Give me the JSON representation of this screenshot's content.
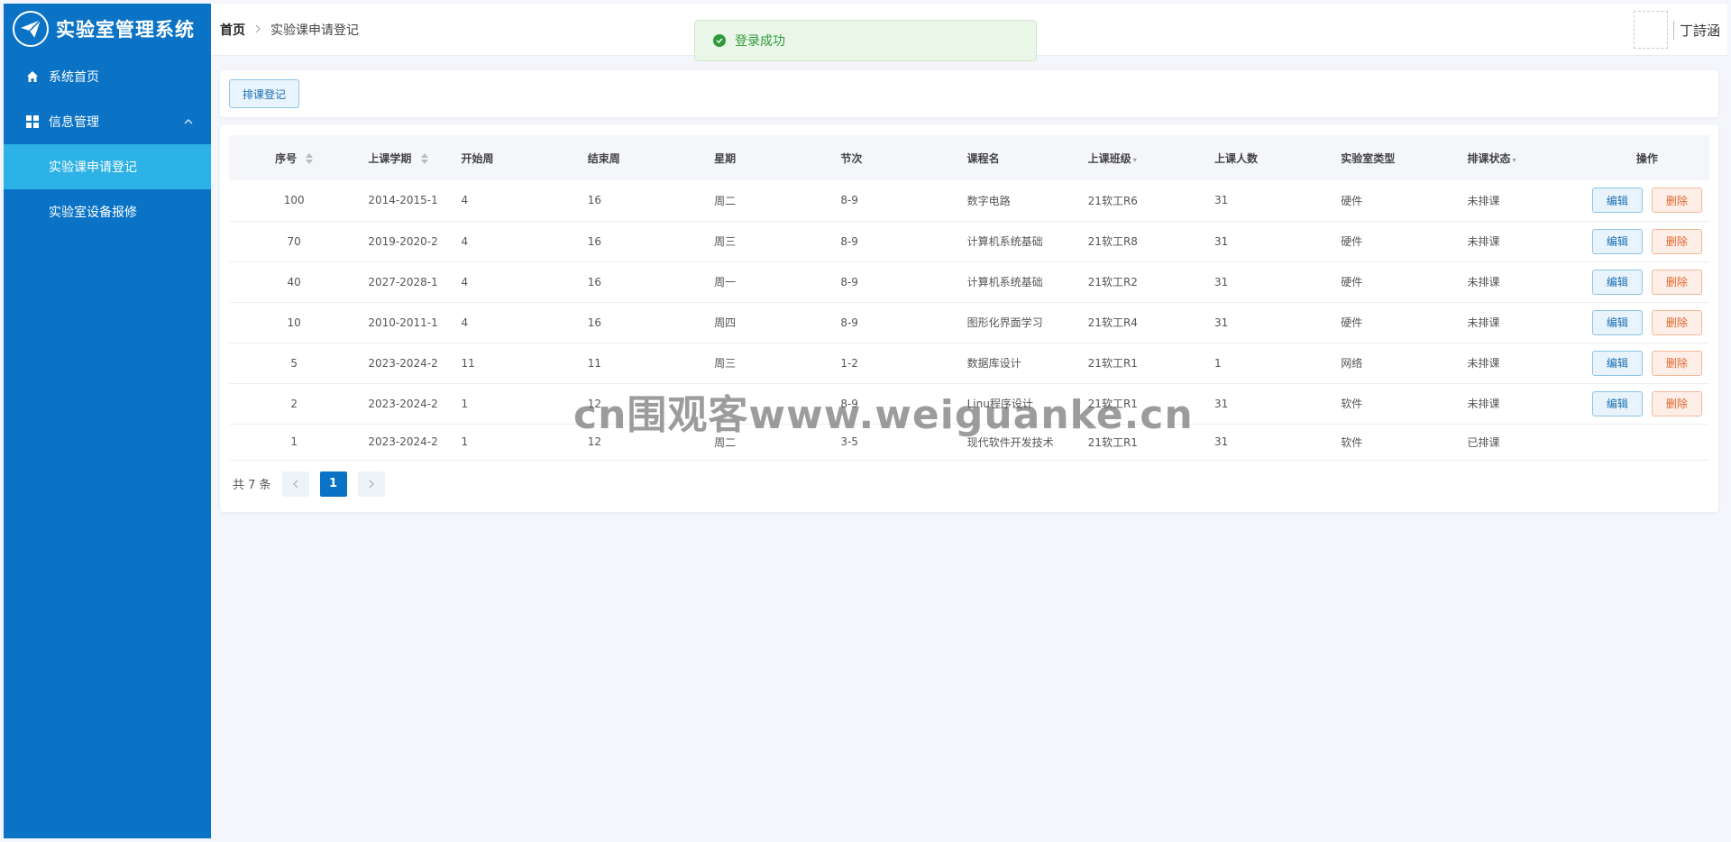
{
  "app": {
    "title": "实验室管理系统"
  },
  "sidebar": {
    "items": [
      {
        "label": "系统首页",
        "icon": "home-icon"
      },
      {
        "label": "信息管理",
        "icon": "grid-icon",
        "expanded": true
      }
    ],
    "submenu": [
      {
        "label": "实验课申请登记",
        "active": true
      },
      {
        "label": "实验室设备报修",
        "active": false
      }
    ]
  },
  "header": {
    "breadcrumb_home": "首页",
    "breadcrumb_current": "实验课申请登记",
    "user_name": "丁詩涵"
  },
  "toast": {
    "message": "登录成功"
  },
  "toolbar": {
    "schedule_label": "排课登记"
  },
  "table": {
    "columns": [
      "序号",
      "上课学期",
      "开始周",
      "结束周",
      "星期",
      "节次",
      "课程名",
      "上课班级",
      "上课人数",
      "实验室类型",
      "排课状态",
      "操作"
    ],
    "rows": [
      [
        "100",
        "2014-2015-1",
        "4",
        "16",
        "周二",
        "8-9",
        "数字电路",
        "21软工R6",
        "31",
        "硬件",
        "未排课"
      ],
      [
        "70",
        "2019-2020-2",
        "4",
        "16",
        "周三",
        "8-9",
        "计算机系统基础",
        "21软工R8",
        "31",
        "硬件",
        "未排课"
      ],
      [
        "40",
        "2027-2028-1",
        "4",
        "16",
        "周一",
        "8-9",
        "计算机系统基础",
        "21软工R2",
        "31",
        "硬件",
        "未排课"
      ],
      [
        "10",
        "2010-2011-1",
        "4",
        "16",
        "周四",
        "8-9",
        "图形化界面学习",
        "21软工R4",
        "31",
        "硬件",
        "未排课"
      ],
      [
        "5",
        "2023-2024-2",
        "11",
        "11",
        "周三",
        "1-2",
        "数据库设计",
        "21软工R1",
        "1",
        "网络",
        "未排课"
      ],
      [
        "2",
        "2023-2024-2",
        "1",
        "12",
        "",
        "8-9",
        "Linu程序设计",
        "21软工R1",
        "31",
        "软件",
        "未排课"
      ],
      [
        "1",
        "2023-2024-2",
        "1",
        "12",
        "周二",
        "3-5",
        "现代软件开发技术",
        "21软工R1",
        "31",
        "软件",
        "已排课"
      ]
    ],
    "edit_label": "编辑",
    "delete_label": "删除"
  },
  "pagination": {
    "total_text": "共 7 条",
    "current_page": "1"
  },
  "watermark": "cn围观客www.weiguanke.cn",
  "colors": {
    "sidebar": "#0a73c6",
    "active_submenu": "#2cb2e6",
    "success": "#2e9a3a",
    "danger": "#e0662e"
  }
}
